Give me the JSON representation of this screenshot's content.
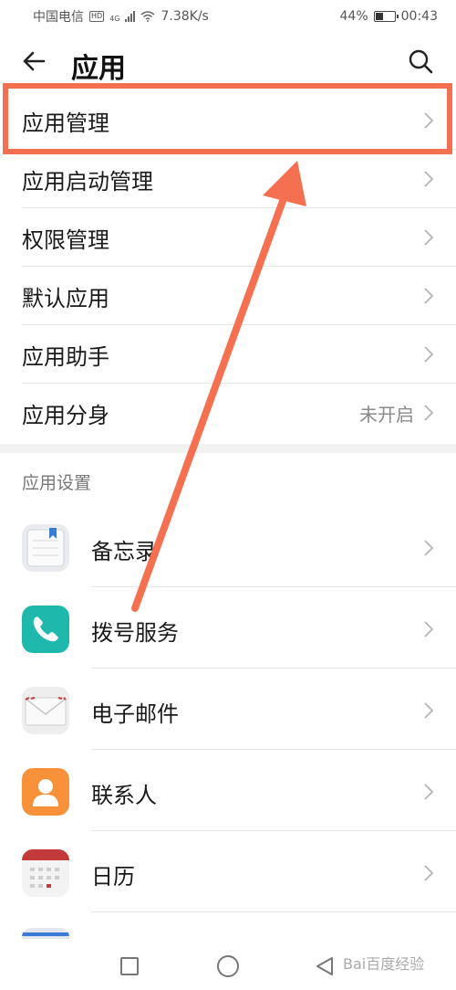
{
  "status_bar": {
    "carrier": "中国电信",
    "hd": "HD",
    "net_type": "4G",
    "speed": "7.38K/s",
    "battery_percent": "44%",
    "battery_level": 0.44,
    "time": "00:43"
  },
  "header": {
    "title": "应用",
    "back_icon": "arrow-left-icon",
    "search_icon": "search-icon"
  },
  "menu": {
    "items": [
      {
        "label": "应用管理"
      },
      {
        "label": "应用启动管理"
      },
      {
        "label": "权限管理"
      },
      {
        "label": "默认应用"
      },
      {
        "label": "应用助手"
      },
      {
        "label": "应用分身",
        "value": "未开启"
      }
    ]
  },
  "section": {
    "title": "应用设置"
  },
  "apps": {
    "items": [
      {
        "label": "备忘录",
        "icon": "notepad-icon"
      },
      {
        "label": "拨号服务",
        "icon": "phone-icon"
      },
      {
        "label": "电子邮件",
        "icon": "envelope-icon"
      },
      {
        "label": "联系人",
        "icon": "contact-icon"
      },
      {
        "label": "日历",
        "icon": "calendar-icon"
      }
    ]
  },
  "colors": {
    "highlight": "#f57050",
    "phone_teal": "#1fb8ad",
    "contact_orange": "#f7913a",
    "calendar_red": "#c23a3a",
    "notepad_blue": "#3a7bd5"
  },
  "watermark": "Bai百度经验"
}
